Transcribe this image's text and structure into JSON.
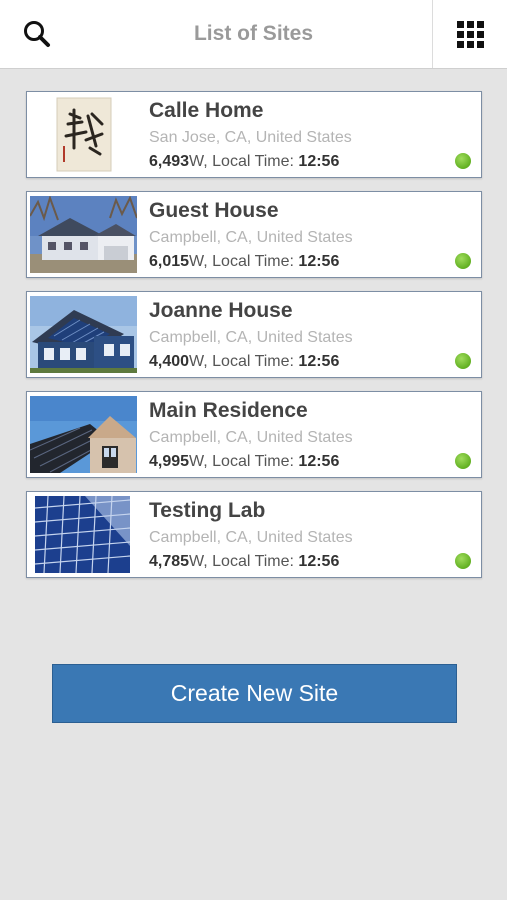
{
  "header": {
    "title": "List of Sites",
    "search_icon": "search-icon",
    "grid_icon": "grid-icon"
  },
  "sites": [
    {
      "name": "Calle Home",
      "location": "San Jose, CA, United States",
      "power": "6,493",
      "power_unit": "W",
      "local_time_label": ", Local Time: ",
      "local_time": "12:56",
      "status_color": "#7cc83a"
    },
    {
      "name": "Guest House",
      "location": "Campbell, CA, United States",
      "power": "6,015",
      "power_unit": "W",
      "local_time_label": ", Local Time: ",
      "local_time": "12:56",
      "status_color": "#7cc83a"
    },
    {
      "name": "Joanne House",
      "location": "Campbell, CA, United States",
      "power": "4,400",
      "power_unit": "W",
      "local_time_label": ", Local Time: ",
      "local_time": "12:56",
      "status_color": "#7cc83a"
    },
    {
      "name": "Main Residence",
      "location": "Campbell, CA, United States",
      "power": "4,995",
      "power_unit": "W",
      "local_time_label": ", Local Time: ",
      "local_time": "12:56",
      "status_color": "#7cc83a"
    },
    {
      "name": "Testing Lab",
      "location": "Campbell, CA, United States",
      "power": "4,785",
      "power_unit": "W",
      "local_time_label": ", Local Time: ",
      "local_time": "12:56",
      "status_color": "#7cc83a"
    }
  ],
  "create_button": {
    "label": "Create New Site"
  },
  "colors": {
    "accent": "#3a78b4",
    "background": "#e4e4e4"
  }
}
